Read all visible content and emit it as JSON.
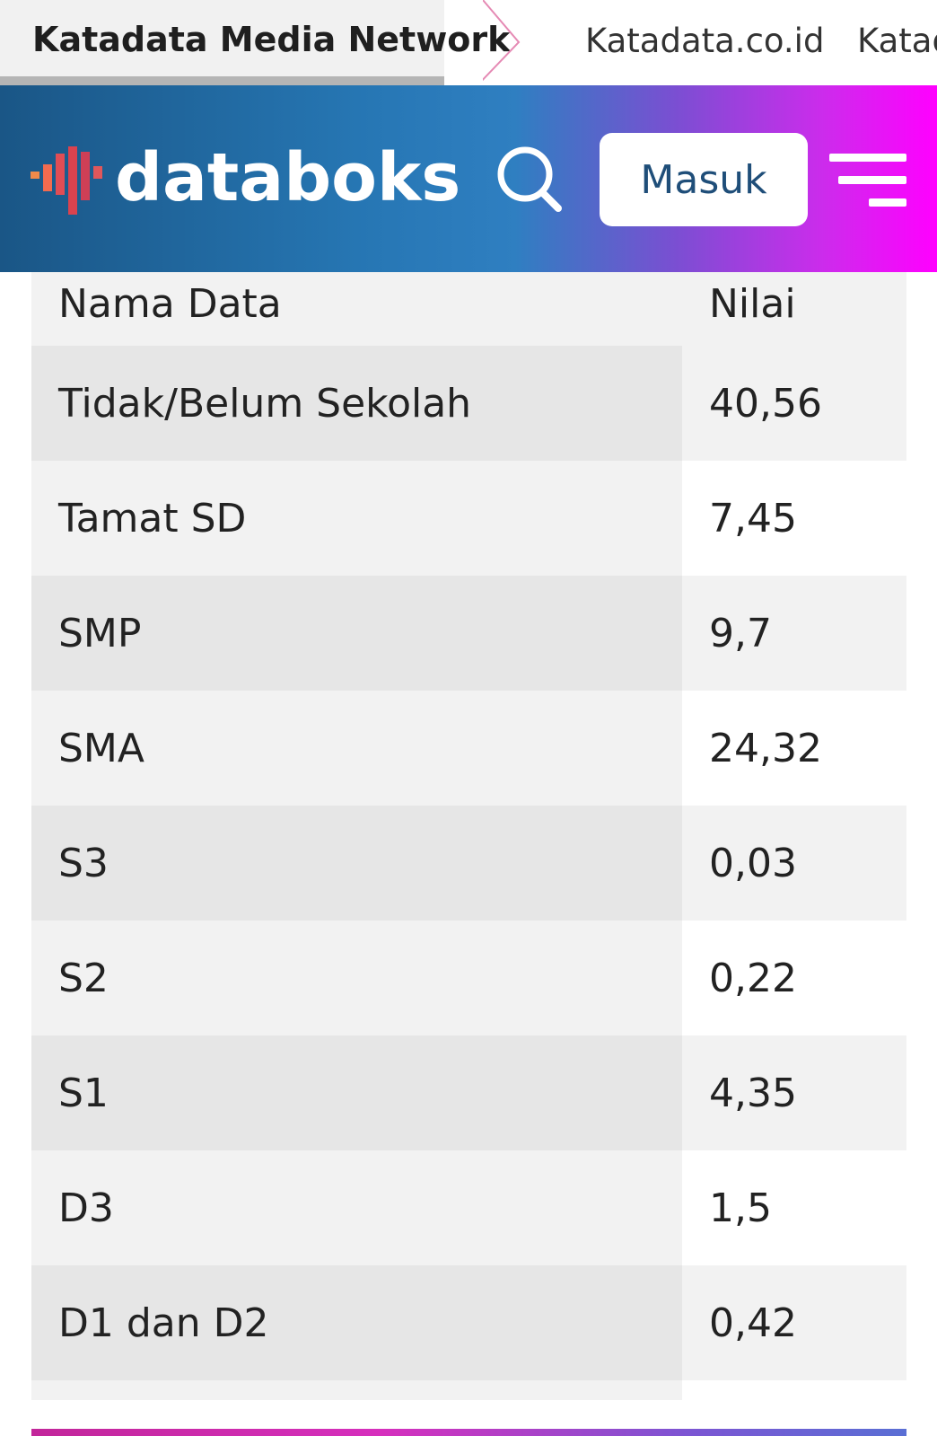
{
  "network": {
    "title": "Katadata Media Network",
    "links": [
      "Katadata.co.id",
      "Katadata"
    ]
  },
  "header": {
    "logo_text": "databoks",
    "login_label": "Masuk",
    "icons": {
      "search": "search-icon",
      "menu": "menu-icon",
      "logo": "databoks-logo-icon"
    },
    "colors": {
      "gradient_start": "#1a5686",
      "gradient_mid": "#2f7fc1",
      "gradient_end": "#ff00ff"
    }
  },
  "table": {
    "headers": {
      "name": "Nama Data",
      "value": "Nilai"
    },
    "rows": [
      {
        "name": "Tidak/Belum Sekolah",
        "value": "40,56"
      },
      {
        "name": "Tamat SD",
        "value": "7,45"
      },
      {
        "name": "SMP",
        "value": "9,7"
      },
      {
        "name": "SMA",
        "value": "24,32"
      },
      {
        "name": "S3",
        "value": "0,03"
      },
      {
        "name": "S2",
        "value": "0,22"
      },
      {
        "name": "S1",
        "value": "4,35"
      },
      {
        "name": "D3",
        "value": "1,5"
      },
      {
        "name": "D1 dan D2",
        "value": "0,42"
      }
    ]
  }
}
